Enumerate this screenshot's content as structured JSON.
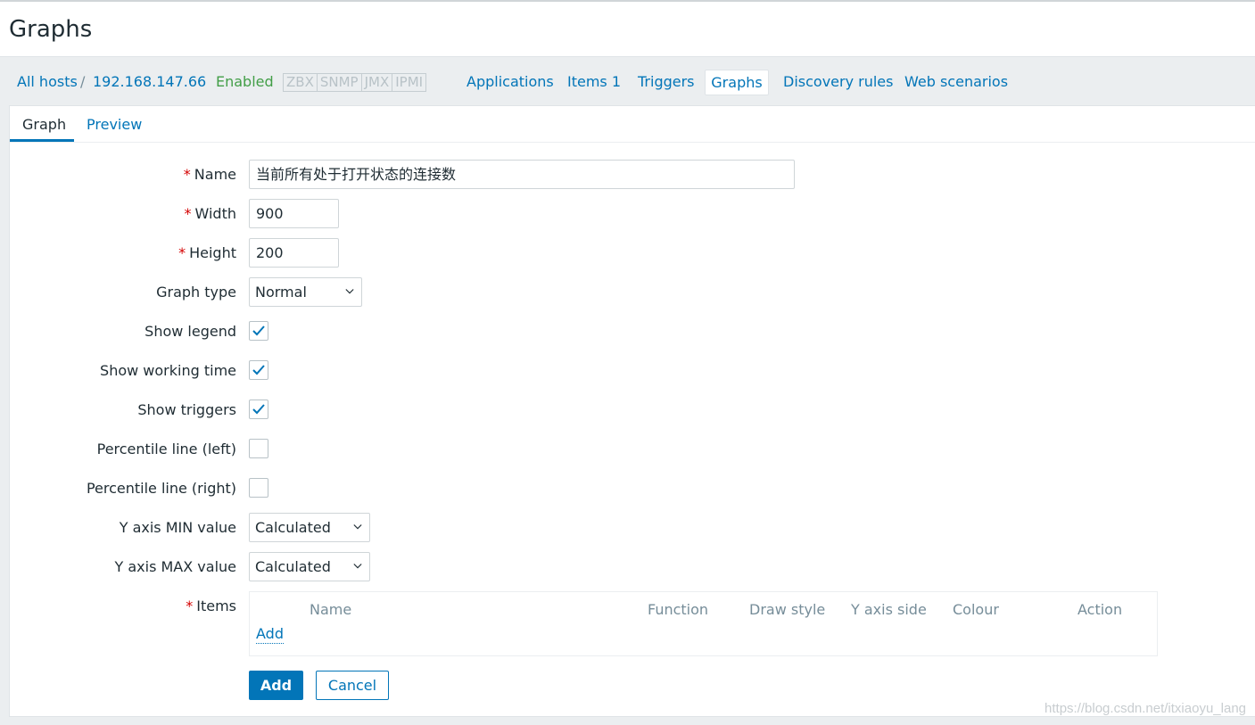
{
  "page": {
    "title": "Graphs"
  },
  "nav": {
    "all_hosts": "All hosts",
    "separator": "/",
    "host": "192.168.147.66",
    "status": "Enabled",
    "availability": [
      "ZBX",
      "SNMP",
      "JMX",
      "IPMI"
    ],
    "applications": "Applications",
    "items": "Items 1",
    "triggers": "Triggers",
    "graphs": "Graphs",
    "discovery_rules": "Discovery rules",
    "web_scenarios": "Web scenarios"
  },
  "tabs": {
    "graph": "Graph",
    "preview": "Preview"
  },
  "form": {
    "required_mark": "*",
    "name_label": "Name",
    "name_value": "当前所有处于打开状态的连接数",
    "width_label": "Width",
    "width_value": "900",
    "height_label": "Height",
    "height_value": "200",
    "graph_type_label": "Graph type",
    "graph_type_value": "Normal",
    "show_legend_label": "Show legend",
    "show_working_time_label": "Show working time",
    "show_triggers_label": "Show triggers",
    "percentile_left_label": "Percentile line (left)",
    "percentile_right_label": "Percentile line (right)",
    "ymin_label": "Y axis MIN value",
    "ymin_value": "Calculated",
    "ymax_label": "Y axis MAX value",
    "ymax_value": "Calculated",
    "items_label": "Items"
  },
  "items_table": {
    "columns": [
      "Name",
      "Function",
      "Draw style",
      "Y axis side",
      "Colour",
      "Action"
    ],
    "add_link": "Add"
  },
  "buttons": {
    "add": "Add",
    "cancel": "Cancel"
  },
  "watermark": "https://blog.csdn.net/itxiaoyu_lang",
  "colors": {
    "accent": "#0275b8",
    "enabled": "#429e47",
    "required": "#d40000"
  }
}
